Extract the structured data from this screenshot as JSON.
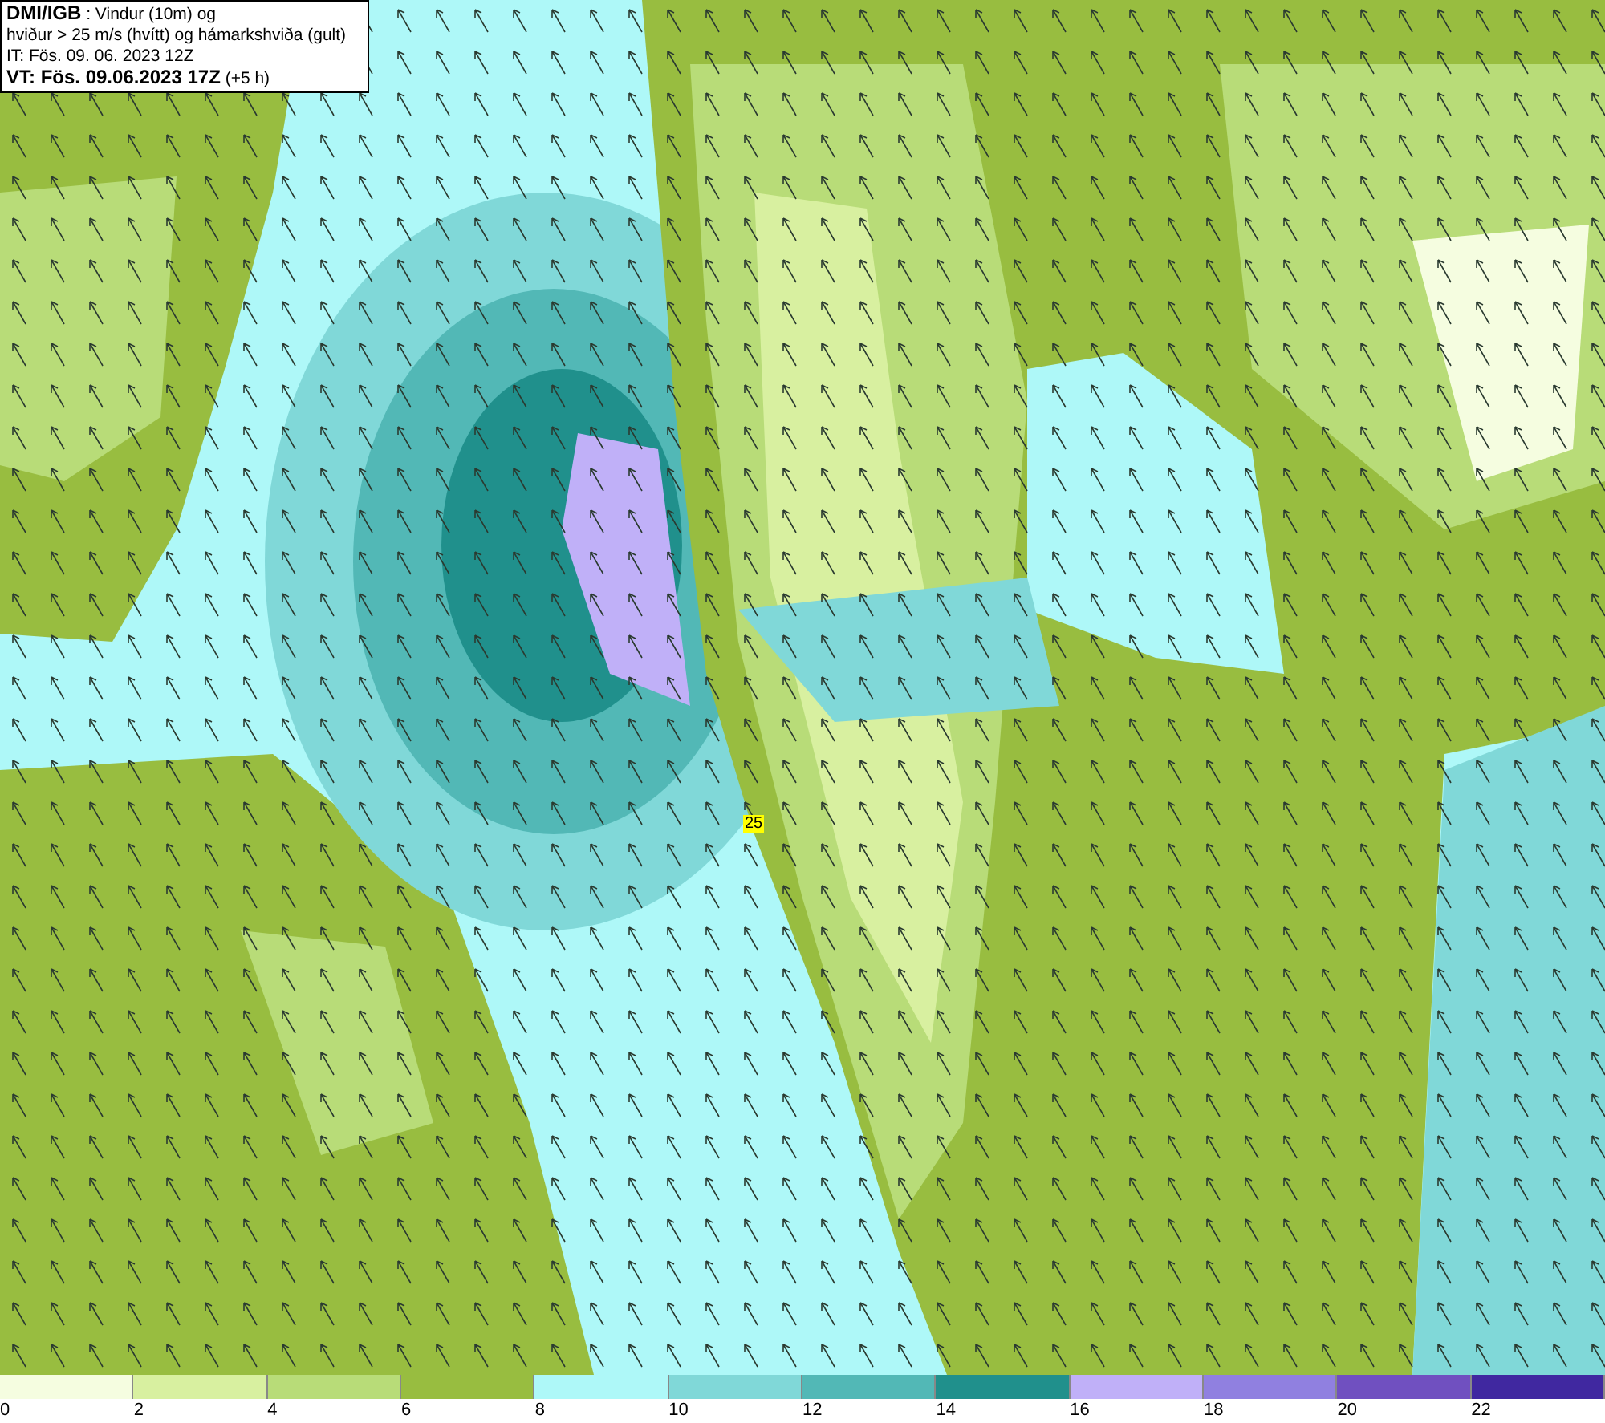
{
  "header": {
    "lines": [
      "**DMI/IGB** : Vindur (10m) og",
      "hviður > 25 m/s (hvítt) og hámarkshviða (gult)",
      "IT: Fös. 09. 06. 2023 12Z",
      "**VT: Fös. 09.06.2023 17Z** (+5 h)"
    ]
  },
  "gust_marker": {
    "label": "25"
  },
  "legend": [
    {
      "label": "0",
      "color": "#f5fde0"
    },
    {
      "label": "2",
      "color": "#d8f0a0"
    },
    {
      "label": "4",
      "color": "#b8dc78"
    },
    {
      "label": "6",
      "color": "#98bd40"
    },
    {
      "label": "8",
      "color": "#aef8f8"
    },
    {
      "label": "10",
      "color": "#80d8d8"
    },
    {
      "label": "12",
      "color": "#52b8b6"
    },
    {
      "label": "14",
      "color": "#20908c"
    },
    {
      "label": "16",
      "color": "#c0b0f8"
    },
    {
      "label": "18",
      "color": "#9080e0"
    },
    {
      "label": "20",
      "color": "#7050c0"
    },
    {
      "label": "22",
      "color": "#4028a0"
    }
  ]
}
